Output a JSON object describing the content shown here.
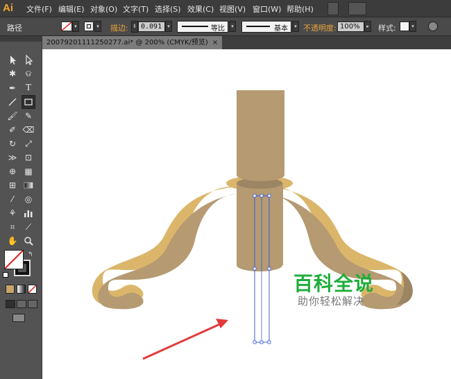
{
  "app": {
    "logo": "Ai"
  },
  "menu": [
    "文件(F)",
    "编辑(E)",
    "对象(O)",
    "文字(T)",
    "选择(S)",
    "效果(C)",
    "视图(V)",
    "窗口(W)",
    "帮助(H)"
  ],
  "options": {
    "selection_label": "路径",
    "stroke_label": "描边:",
    "stroke_weight": "0.091",
    "stroke_profile": "等比",
    "brush": "基本",
    "opacity_label": "不透明度:",
    "opacity_value": "100%",
    "style_label": "样式:"
  },
  "document": {
    "tab_title": "20079201111250277.ai* @ 200% (CMYK/预览)",
    "close_glyph": "×"
  },
  "watermark": {
    "title": "百科全说",
    "subtitle": "助你轻松解决"
  },
  "colors": {
    "wood": "#b59a72",
    "wood_dark": "#9b8563",
    "rim": "#ddb869",
    "selection": "#3b5bdb",
    "arrow": "#e23a3a",
    "watermark": "#1fad3b",
    "ui_bg": "#535353"
  }
}
